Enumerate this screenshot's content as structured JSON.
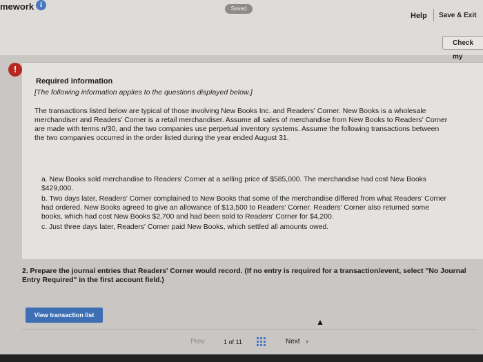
{
  "app": {
    "title": "mework",
    "saved": "Saved"
  },
  "toolbar": {
    "help": "Help",
    "save_exit": "Save & Exit",
    "check": "Check my"
  },
  "content": {
    "required_title": "Required information",
    "required_note": "[The following information applies to the questions displayed below.]",
    "paragraph": "The transactions listed below are typical of those involving New Books Inc. and Readers' Corner. New Books is a wholesale merchandiser and Readers' Corner is a retail merchandiser. Assume all sales of merchandise from New Books to Readers' Corner are made with terms n/30, and the two companies use perpetual inventory systems. Assume the following transactions between the two companies occurred in the order listed during the year ended August 31.",
    "items": [
      {
        "letter": "a.",
        "text": "New Books sold merchandise to Readers' Corner at a selling price of $585,000. The merchandise had cost New Books $429,000."
      },
      {
        "letter": "b.",
        "text": "Two days later, Readers' Corner complained to New Books that some of the merchandise differed from what Readers' Corner had ordered. New Books agreed to give an allowance of $13,500 to Readers' Corner. Readers' Corner also returned some books, which had cost New Books $2,700 and had been sold to Readers' Corner for $4,200."
      },
      {
        "letter": "c.",
        "text": "Just three days later, Readers' Corner paid New Books, which settled all amounts owed."
      }
    ],
    "question": "2. Prepare the journal entries that Readers' Corner would record. (If no entry is required for a transaction/event, select \"No Journal Entry Required\" in the first account field.)"
  },
  "actions": {
    "view_transactions": "View transaction list"
  },
  "pagination": {
    "prev": "Prev",
    "page_info": "1 of 11",
    "next": "Next"
  },
  "icons": {
    "info": "info-icon",
    "alert": "alert-icon",
    "grid": "grid-icon",
    "next_chevron": "chevron-right-icon"
  },
  "colors": {
    "accent": "#3e6fb4",
    "alert": "#b8281f"
  }
}
